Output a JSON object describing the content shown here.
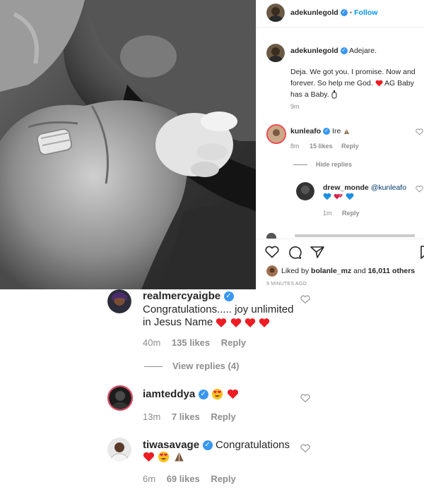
{
  "post": {
    "author": "adekunlegold",
    "follow_label": "Follow",
    "dot": "•",
    "caption_first": "Adejare.",
    "caption_body": "Deja. We got you. I promise. Now and forever. So help me God.",
    "caption_tail": "AG Baby has a Baby.",
    "caption_time": "9m"
  },
  "panel_comments": [
    {
      "user": "kunleafo",
      "text": "Ire",
      "time": "8m",
      "likes": "15 likes",
      "reply": "Reply"
    },
    {
      "user": "drew_monde",
      "mention": "@kunleafo",
      "time": "1m",
      "reply": "Reply"
    }
  ],
  "hide_replies": "Hide replies",
  "likes_line": {
    "prefix": "Liked by",
    "user": "bolanle_mz",
    "middle": "and",
    "count": "16,011 others"
  },
  "post_time": "9 MINUTES AGO",
  "comments": [
    {
      "user": "realmercyaigbe",
      "text": "Congratulations..... joy unlimited in Jesus Name",
      "time": "40m",
      "likes": "135 likes",
      "reply": "Reply",
      "view_replies": "View replies (4)"
    },
    {
      "user": "iamteddya",
      "text": "",
      "time": "13m",
      "likes": "7 likes",
      "reply": "Reply"
    },
    {
      "user": "tiwasavage",
      "text": "Congratulations",
      "time": "6m",
      "likes": "69 likes",
      "reply": "Reply"
    }
  ],
  "colors": {
    "link_blue": "#0095f6",
    "verified_blue": "#3897f0",
    "heart_red": "#ed1c24",
    "muted": "#8e8e8e"
  }
}
